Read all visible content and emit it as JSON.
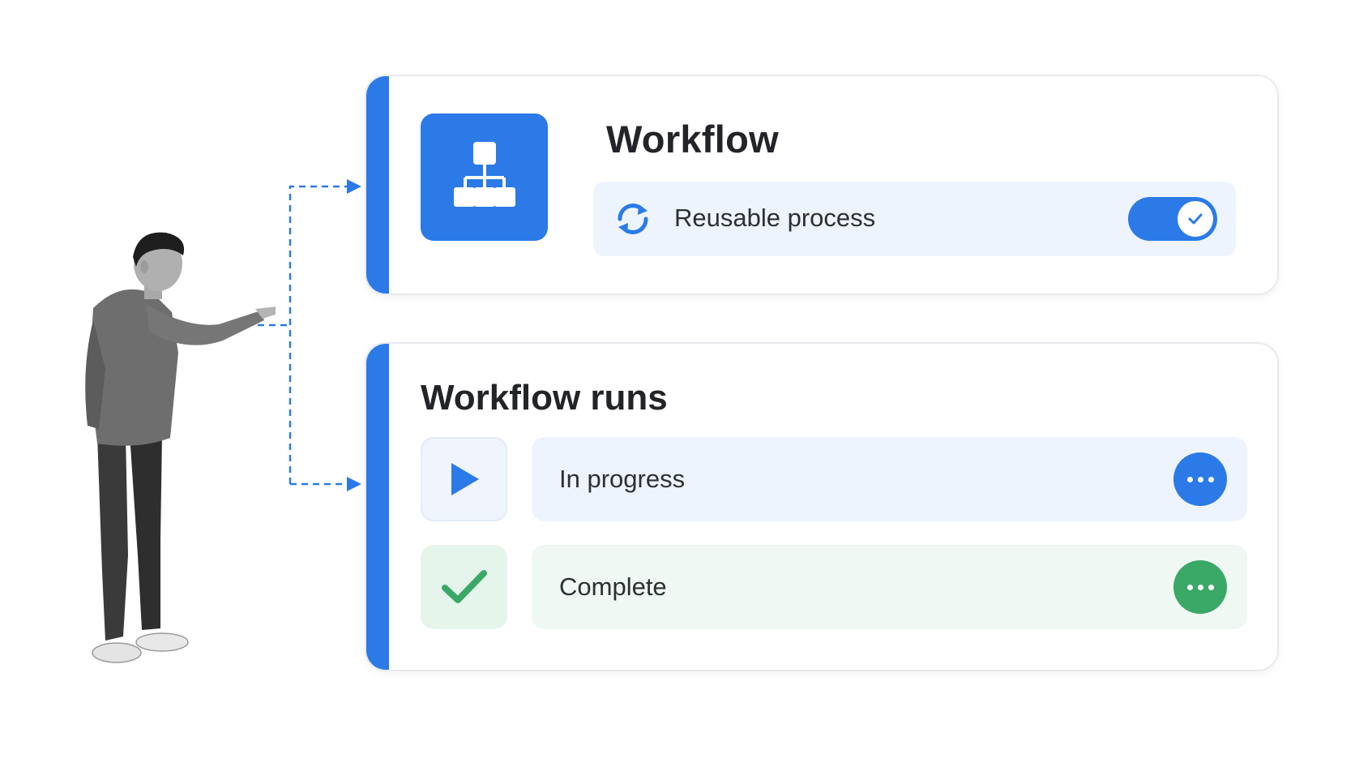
{
  "workflow_card": {
    "title": "Workflow",
    "icon": "org-chart-icon",
    "reusable": {
      "icon": "refresh-icon",
      "label": "Reusable process",
      "toggle_on": true
    }
  },
  "runs_card": {
    "title": "Workflow runs",
    "runs": [
      {
        "status_icon": "play-icon",
        "label": "In progress",
        "menu_icon": "more-icon"
      },
      {
        "status_icon": "check-icon",
        "label": "Complete",
        "menu_icon": "more-icon"
      }
    ]
  },
  "colors": {
    "accent_blue": "#2b7ae8",
    "success_green": "#3aa867",
    "progress_row_bg": "#eef4fd",
    "complete_row_bg": "#eff8f3"
  }
}
